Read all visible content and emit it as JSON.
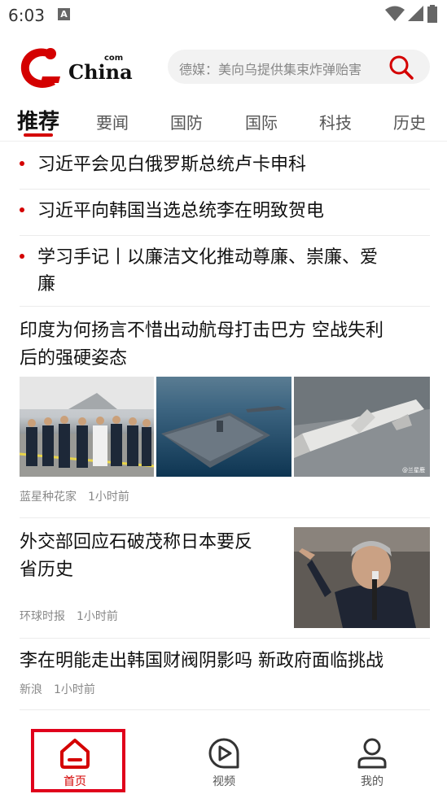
{
  "status_bar": {
    "time": "6:03",
    "indicator": "A"
  },
  "header": {
    "logo_text": "China",
    "logo_superscript": "com",
    "search_placeholder": "德媒：美向乌提供集束炸弹贻害"
  },
  "tabs": [
    {
      "label": "推荐",
      "active": true
    },
    {
      "label": "要闻"
    },
    {
      "label": "国防"
    },
    {
      "label": "国际"
    },
    {
      "label": "科技"
    },
    {
      "label": "历史"
    }
  ],
  "top_news": [
    {
      "lines": [
        "习近平会见白俄罗斯总统卢卡申科"
      ]
    },
    {
      "lines": [
        "习近平向韩国当选总统李在明致贺电"
      ]
    },
    {
      "lines": [
        "学习手记丨以廉洁文化推动尊廉、崇廉、爱",
        "廉"
      ]
    }
  ],
  "articles": [
    {
      "title_lines": [
        "印度为何扬言不惜出动航母打击巴方 空战失利",
        "后的强硬姿态"
      ],
      "source": "蓝星种花家",
      "time": "1小时前",
      "thumb_caption": "@兰星鹿"
    },
    {
      "title_lines": [
        "外交部回应石破茂称日本要反",
        "省历史"
      ],
      "source": "环球时报",
      "time": "1小时前"
    },
    {
      "title_lines": [
        "李在明能走出韩国财阀阴影吗 新政府面临挑战"
      ],
      "source": "新浪",
      "time": "1小时前"
    }
  ],
  "bottom_nav": [
    {
      "label": "首页",
      "active": true
    },
    {
      "label": "视频"
    },
    {
      "label": "我的"
    }
  ],
  "colors": {
    "accent": "#d40000",
    "text": "#111111",
    "meta": "#888888"
  }
}
